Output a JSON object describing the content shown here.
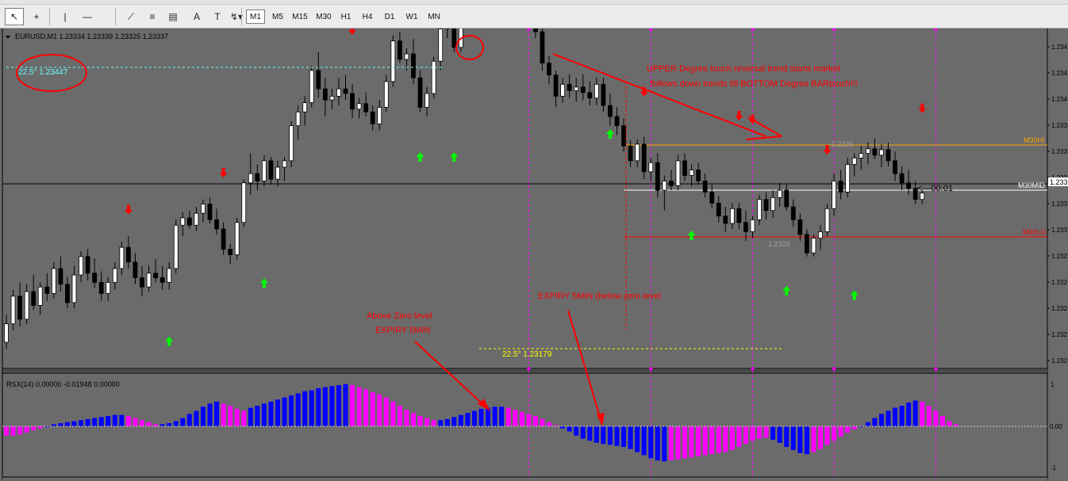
{
  "toolbar": {
    "tools": [
      {
        "name": "cursor-tool",
        "glyph": "↖"
      },
      {
        "name": "crosshair-tool",
        "glyph": "+"
      },
      {
        "name": "vertical-line-tool",
        "glyph": "|"
      },
      {
        "name": "horizontal-line-tool",
        "glyph": "—"
      },
      {
        "name": "trendline-tool",
        "glyph": "⟋"
      },
      {
        "name": "channel-tool",
        "glyph": "≡"
      },
      {
        "name": "fibonacci-tool",
        "glyph": "▤"
      },
      {
        "name": "text-tool",
        "glyph": "A"
      },
      {
        "name": "text-label-tool",
        "glyph": "T"
      },
      {
        "name": "arrows-tool",
        "glyph": "↯▾"
      }
    ],
    "timeframes": [
      "M1",
      "M5",
      "M15",
      "M30",
      "H1",
      "H4",
      "D1",
      "W1",
      "MN"
    ],
    "active_timeframe": "M1"
  },
  "main_chart": {
    "header": "EURUSD,M1  1.23334 1.23339 1.23325 1.23337",
    "label_topleft": "22.5° 1.23447",
    "label_bottom": "22.5° 1.23179",
    "annotation_top_line1": "UPPER Degree touch reversal trend starts market",
    "annotation_top_line2": "follows down trends till BOTTOM Degree BARtouch!!!",
    "annotation_expiry_below": "EXPIRY 5MIN (below zero level",
    "annotation_above_line1": "Above Zero level",
    "annotation_above_line2": "EXPIRY 5MIN",
    "countdown": "<---00:01",
    "level_high": "M30HI",
    "level_mid": "M30MID",
    "level_low": "M30LO",
    "price_high_marker": "1.2336",
    "price_low_marker": "1.2329",
    "price_axis": [
      "1.234",
      "1.234",
      "1.234",
      "1.233",
      "1.233",
      "1.233",
      "1.233",
      "1.233",
      "1.232",
      "1.232",
      "1.232",
      "1.232",
      "1.232"
    ],
    "current_price": "1.233"
  },
  "indicator": {
    "header": "RSX(14) 0.00000 -0.01948 0.00000",
    "axis": [
      "1",
      "0.00",
      "-1"
    ]
  },
  "colors": {
    "background": "#6b6b6b",
    "bull_candle": "#ffffff",
    "bear_candle": "#000000",
    "up_arrow": "#00ff00",
    "down_arrow": "#ff0000",
    "magenta_line": "#ff00ff",
    "hi_level": "#ffa500",
    "lo_level": "#ff0000",
    "mid_level": "#ffffff",
    "annotation_red": "#ff0000",
    "cyan_label": "#66ffff",
    "yellow_label": "#ffff00",
    "hist_blue": "#0000ff",
    "hist_magenta": "#ff00ff"
  },
  "chart_data": {
    "type": "candlestick",
    "symbol": "EURUSD",
    "timeframe": "M1",
    "price_range": [
      1.2315,
      1.235
    ],
    "candles": [
      [
        1.23175,
        1.23205,
        1.23168,
        1.23195
      ],
      [
        1.23195,
        1.23232,
        1.23188,
        1.23225
      ],
      [
        1.23225,
        1.2324,
        1.23192,
        1.232
      ],
      [
        1.232,
        1.23238,
        1.23195,
        1.2323
      ],
      [
        1.2323,
        1.23248,
        1.2321,
        1.23215
      ],
      [
        1.23215,
        1.2324,
        1.23205,
        1.23235
      ],
      [
        1.23235,
        1.2325,
        1.2322,
        1.23228
      ],
      [
        1.23228,
        1.23262,
        1.23222,
        1.23255
      ],
      [
        1.23255,
        1.23268,
        1.2323,
        1.23238
      ],
      [
        1.23238,
        1.23246,
        1.23212,
        1.23218
      ],
      [
        1.23218,
        1.23258,
        1.23212,
        1.23248
      ],
      [
        1.23248,
        1.23274,
        1.2324,
        1.23268
      ],
      [
        1.23268,
        1.23276,
        1.23242,
        1.2325
      ],
      [
        1.2325,
        1.23266,
        1.23234,
        1.2324
      ],
      [
        1.2324,
        1.23252,
        1.2322,
        1.23228
      ],
      [
        1.23228,
        1.23246,
        1.2322,
        1.2324
      ],
      [
        1.2324,
        1.23262,
        1.23232,
        1.23255
      ],
      [
        1.23255,
        1.23284,
        1.23248,
        1.23278
      ],
      [
        1.23278,
        1.2329,
        1.23255,
        1.23262
      ],
      [
        1.23262,
        1.23272,
        1.23238,
        1.23245
      ],
      [
        1.23245,
        1.23258,
        1.23225,
        1.23235
      ],
      [
        1.23235,
        1.23258,
        1.2323,
        1.2325
      ],
      [
        1.2325,
        1.23265,
        1.2324,
        1.23245
      ],
      [
        1.23245,
        1.23258,
        1.23232,
        1.2324
      ],
      [
        1.2324,
        1.23262,
        1.23232,
        1.23255
      ],
      [
        1.23255,
        1.23308,
        1.2325,
        1.23302
      ],
      [
        1.23302,
        1.23316,
        1.2329,
        1.2331
      ],
      [
        1.2331,
        1.23318,
        1.23298,
        1.23302
      ],
      [
        1.23302,
        1.23322,
        1.23296,
        1.23315
      ],
      [
        1.23315,
        1.2333,
        1.23305,
        1.23325
      ],
      [
        1.23325,
        1.23332,
        1.23304,
        1.23308
      ],
      [
        1.23308,
        1.2332,
        1.23292,
        1.23298
      ],
      [
        1.23298,
        1.23305,
        1.2327,
        1.23276
      ],
      [
        1.23276,
        1.23282,
        1.2326,
        1.2327
      ],
      [
        1.2327,
        1.2331,
        1.23265,
        1.23305
      ],
      [
        1.23305,
        1.23352,
        1.233,
        1.23348
      ],
      [
        1.23348,
        1.2338,
        1.23335,
        1.23358
      ],
      [
        1.23358,
        1.23368,
        1.2334,
        1.2335
      ],
      [
        1.2335,
        1.23378,
        1.23344,
        1.23372
      ],
      [
        1.23372,
        1.23376,
        1.23346,
        1.23352
      ],
      [
        1.23352,
        1.23372,
        1.23344,
        1.23365
      ],
      [
        1.23365,
        1.23376,
        1.2335,
        1.23372
      ],
      [
        1.23372,
        1.23415,
        1.23365,
        1.2341
      ],
      [
        1.2341,
        1.23432,
        1.23395,
        1.23425
      ],
      [
        1.23425,
        1.23442,
        1.2341,
        1.23435
      ],
      [
        1.23435,
        1.23475,
        1.2343,
        1.2347
      ],
      [
        1.2347,
        1.2349,
        1.2344,
        1.2345
      ],
      [
        1.2345,
        1.23462,
        1.2342,
        1.23438
      ],
      [
        1.23438,
        1.2345,
        1.23428,
        1.23442
      ],
      [
        1.23442,
        1.23462,
        1.23432,
        1.2345
      ],
      [
        1.2345,
        1.23465,
        1.23438,
        1.23445
      ],
      [
        1.23445,
        1.23455,
        1.23418,
        1.23428
      ],
      [
        1.23428,
        1.2344,
        1.23418,
        1.23434
      ],
      [
        1.23434,
        1.23446,
        1.2342,
        1.23425
      ],
      [
        1.23425,
        1.23432,
        1.23405,
        1.23412
      ],
      [
        1.23412,
        1.23438,
        1.23405,
        1.2343
      ],
      [
        1.2343,
        1.23465,
        1.23425,
        1.23458
      ],
      [
        1.23458,
        1.23508,
        1.23452,
        1.23502
      ],
      [
        1.23502,
        1.23512,
        1.23478,
        1.23482
      ],
      [
        1.23482,
        1.23494,
        1.2347,
        1.23488
      ],
      [
        1.23488,
        1.23504,
        1.23455,
        1.23462
      ],
      [
        1.23462,
        1.2347,
        1.23425,
        1.2343
      ],
      [
        1.2343,
        1.23452,
        1.2342,
        1.23445
      ],
      [
        1.23445,
        1.23485,
        1.2344,
        1.2348
      ],
      [
        1.2348,
        1.2352,
        1.2347,
        1.23515
      ],
      [
        1.23515,
        1.2354,
        1.23505,
        1.2353
      ],
      [
        1.2353,
        1.23548,
        1.2349,
        1.23495
      ],
      [
        1.23495,
        1.2355,
        1.2349,
        1.23545
      ],
      [
        1.23545,
        1.23562,
        1.2353,
        1.23552
      ],
      [
        1.23552,
        1.23575,
        1.2354,
        1.23565
      ],
      [
        1.23565,
        1.2358,
        1.23548,
        1.23558
      ],
      [
        1.23558,
        1.2357,
        1.23538,
        1.23545
      ],
      [
        1.23545,
        1.23562,
        1.23535,
        1.23552
      ],
      [
        1.23552,
        1.23575,
        1.2354,
        1.23568
      ],
      [
        1.23568,
        1.23572,
        1.2353,
        1.23535
      ],
      [
        1.23535,
        1.23556,
        1.23528,
        1.23548
      ],
      [
        1.23548,
        1.23568,
        1.2354,
        1.2356
      ],
      [
        1.2356,
        1.23566,
        1.23532,
        1.2354
      ],
      [
        1.2354,
        1.23545,
        1.23505,
        1.23512
      ],
      [
        1.23512,
        1.2352,
        1.2347,
        1.23478
      ],
      [
        1.23478,
        1.23486,
        1.23455,
        1.23465
      ],
      [
        1.23465,
        1.2347,
        1.2343,
        1.23442
      ],
      [
        1.23442,
        1.23462,
        1.23435,
        1.23455
      ],
      [
        1.23455,
        1.23466,
        1.2344,
        1.23448
      ],
      [
        1.23448,
        1.23462,
        1.23436,
        1.23452
      ],
      [
        1.23452,
        1.23466,
        1.23438,
        1.23446
      ],
      [
        1.23446,
        1.23458,
        1.23432,
        1.2344
      ],
      [
        1.2344,
        1.23462,
        1.23432,
        1.23455
      ],
      [
        1.23455,
        1.23462,
        1.23425,
        1.23432
      ],
      [
        1.23432,
        1.23445,
        1.2341,
        1.2342
      ],
      [
        1.2342,
        1.2343,
        1.234,
        1.2341
      ],
      [
        1.2341,
        1.23418,
        1.23382,
        1.23388
      ],
      [
        1.23388,
        1.23394,
        1.23365,
        1.23372
      ],
      [
        1.23372,
        1.23395,
        1.23365,
        1.2339
      ],
      [
        1.2339,
        1.23398,
        1.23352,
        1.2336
      ],
      [
        1.2336,
        1.23375,
        1.2335,
        1.2337
      ],
      [
        1.2337,
        1.2338,
        1.23332,
        1.2334
      ],
      [
        1.2334,
        1.23356,
        1.23318,
        1.2335
      ],
      [
        1.2335,
        1.23362,
        1.2334,
        1.23345
      ],
      [
        1.23345,
        1.23378,
        1.2334,
        1.23372
      ],
      [
        1.23372,
        1.2338,
        1.2335,
        1.23356
      ],
      [
        1.23356,
        1.23368,
        1.23344,
        1.23362
      ],
      [
        1.23362,
        1.2337,
        1.23346,
        1.2335
      ],
      [
        1.2335,
        1.23358,
        1.23332,
        1.23338
      ],
      [
        1.23338,
        1.23346,
        1.2332,
        1.23326
      ],
      [
        1.23326,
        1.23334,
        1.23305,
        1.23312
      ],
      [
        1.23312,
        1.23322,
        1.23295,
        1.23304
      ],
      [
        1.23304,
        1.23326,
        1.23298,
        1.2332
      ],
      [
        1.2332,
        1.23326,
        1.23298,
        1.23305
      ],
      [
        1.23305,
        1.23318,
        1.23285,
        1.23295
      ],
      [
        1.23295,
        1.23312,
        1.23288,
        1.23308
      ],
      [
        1.23308,
        1.23335,
        1.23302,
        1.2333
      ],
      [
        1.2333,
        1.23338,
        1.23308,
        1.23318
      ],
      [
        1.23318,
        1.2334,
        1.2331,
        1.23332
      ],
      [
        1.23332,
        1.23348,
        1.23322,
        1.2334
      ],
      [
        1.2334,
        1.23346,
        1.23318,
        1.23322
      ],
      [
        1.23322,
        1.2333,
        1.233,
        1.23308
      ],
      [
        1.23308,
        1.23315,
        1.23285,
        1.23292
      ],
      [
        1.23292,
        1.23298,
        1.23268,
        1.23272
      ],
      [
        1.23272,
        1.23292,
        1.23268,
        1.23288
      ],
      [
        1.23288,
        1.23302,
        1.23275,
        1.23295
      ],
      [
        1.23295,
        1.23325,
        1.2329,
        1.2332
      ],
      [
        1.2332,
        1.23358,
        1.23312,
        1.2335
      ],
      [
        1.2335,
        1.23362,
        1.2333,
        1.23338
      ],
      [
        1.23338,
        1.23375,
        1.23332,
        1.23368
      ],
      [
        1.23368,
        1.2338,
        1.23355,
        1.23375
      ],
      [
        1.23375,
        1.23388,
        1.23362,
        1.2338
      ],
      [
        1.2338,
        1.23392,
        1.23368,
        1.23385
      ],
      [
        1.23385,
        1.23396,
        1.23374,
        1.23378
      ],
      [
        1.23378,
        1.2339,
        1.23365,
        1.23384
      ],
      [
        1.23384,
        1.23392,
        1.23366,
        1.23372
      ],
      [
        1.23372,
        1.23382,
        1.2335,
        1.23358
      ],
      [
        1.23358,
        1.23366,
        1.2334,
        1.23348
      ],
      [
        1.23348,
        1.23362,
        1.23335,
        1.23342
      ],
      [
        1.23342,
        1.2335,
        1.23325,
        1.2333
      ],
      [
        1.2333,
        1.2334,
        1.23325,
        1.23337
      ]
    ],
    "up_arrows": [
      [
        24,
        1.23195
      ],
      [
        38,
        1.23258
      ],
      [
        61,
        1.23395
      ],
      [
        66,
        1.23395
      ],
      [
        89,
        1.2342
      ],
      [
        101,
        1.2331
      ],
      [
        115,
        1.2325
      ],
      [
        125,
        1.23245
      ]
    ],
    "down_arrows": [
      [
        18,
        1.233
      ],
      [
        32,
        1.2334
      ],
      [
        51,
        1.23495
      ],
      [
        65,
        1.2352
      ],
      [
        74,
        1.23578
      ],
      [
        94,
        1.23428
      ],
      [
        108,
        1.23402
      ],
      [
        110,
        1.23398
      ],
      [
        121,
        1.23365
      ],
      [
        135,
        1.2341
      ]
    ],
    "levels": {
      "hi": 1.23395,
      "mid": 1.23335,
      "low": 1.2326
    },
    "vertical_markers": [
      77,
      95,
      110,
      122,
      137
    ],
    "rsx": {
      "range": [
        -1,
        1
      ],
      "values": [
        -0.09,
        -0.09,
        -0.08,
        -0.06,
        -0.04,
        -0.02,
        0.0,
        0.02,
        0.03,
        0.04,
        0.05,
        0.06,
        0.07,
        0.08,
        0.09,
        0.1,
        0.11,
        0.11,
        0.1,
        0.08,
        0.06,
        0.04,
        0.02,
        0.02,
        0.03,
        0.05,
        0.08,
        0.12,
        0.15,
        0.19,
        0.22,
        0.24,
        0.22,
        0.2,
        0.17,
        0.15,
        0.18,
        0.2,
        0.22,
        0.24,
        0.26,
        0.28,
        0.3,
        0.32,
        0.34,
        0.35,
        0.37,
        0.38,
        0.39,
        0.4,
        0.41,
        0.4,
        0.38,
        0.36,
        0.33,
        0.31,
        0.28,
        0.24,
        0.2,
        0.16,
        0.13,
        0.1,
        0.08,
        0.06,
        0.06,
        0.07,
        0.09,
        0.11,
        0.13,
        0.15,
        0.17,
        0.18,
        0.19,
        0.19,
        0.18,
        0.16,
        0.14,
        0.12,
        0.1,
        0.07,
        0.04,
        0.01,
        -0.02,
        -0.05,
        -0.09,
        -0.12,
        -0.14,
        -0.16,
        -0.17,
        -0.18,
        -0.19,
        -0.2,
        -0.22,
        -0.25,
        -0.28,
        -0.31,
        -0.33,
        -0.34,
        -0.33,
        -0.32,
        -0.31,
        -0.3,
        -0.29,
        -0.28,
        -0.27,
        -0.26,
        -0.25,
        -0.23,
        -0.2,
        -0.17,
        -0.14,
        -0.12,
        -0.11,
        -0.13,
        -0.16,
        -0.2,
        -0.23,
        -0.26,
        -0.27,
        -0.25,
        -0.22,
        -0.18,
        -0.14,
        -0.1,
        -0.06,
        -0.03,
        0.0,
        0.04,
        0.08,
        0.12,
        0.15,
        0.18,
        0.2,
        0.23,
        0.25,
        0.24,
        0.2,
        0.15,
        0.1,
        0.05,
        0.02
      ]
    }
  }
}
